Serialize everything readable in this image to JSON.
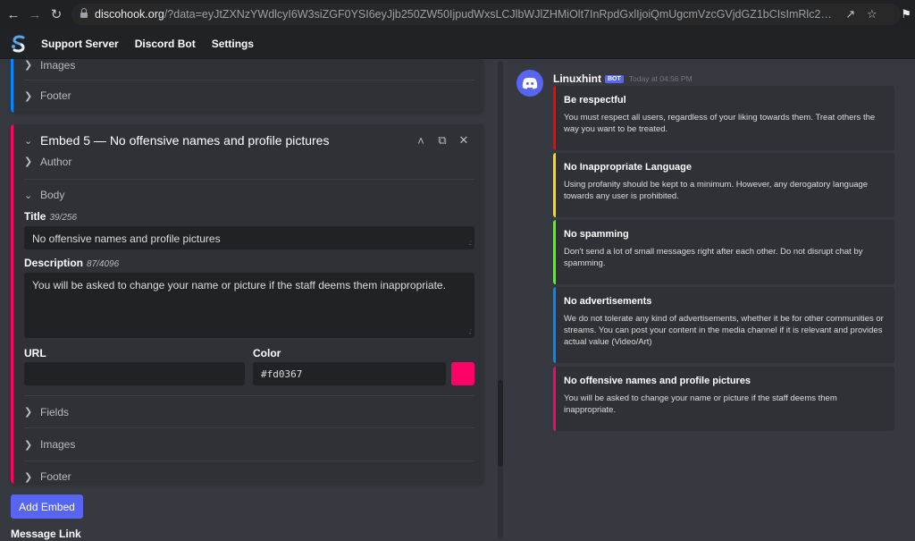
{
  "browser": {
    "url_host": "discohook.org",
    "url_rest": "/?data=eyJtZXNzYWdlcyI6W3siZGF0YSI6eyJjb250ZW50IjpudWxsLCJlbWJlZHMiOlt7InRpdGxlIjoiQmUgcmVzcGVjdGZ1bCIsImRlc2NyaXB0aW9uIjoiWW91IG11c3QgcmVzcGVjj...",
    "icons": [
      "back-arrow",
      "forward-arrow",
      "reload",
      "lock",
      "share",
      "star",
      "extensions"
    ]
  },
  "header": {
    "nav": [
      "Support Server",
      "Discord Bot",
      "Settings"
    ]
  },
  "editor": {
    "prev_embed": {
      "accent": "#0088ff",
      "sections": [
        "Images",
        "Footer"
      ]
    },
    "embed5": {
      "accent": "#fd0367",
      "header_title": "Embed 5 — No offensive names and profile pictures",
      "author_label": "Author",
      "body_label": "Body",
      "title_label": "Title",
      "title_count": "39/256",
      "title_value": "No offensive names and profile pictures",
      "description_label": "Description",
      "description_count": "87/4096",
      "description_value": "You will be asked to change your name or picture if the staff deems them inappropriate.",
      "url_label": "URL",
      "url_value": "",
      "color_label": "Color",
      "color_value": "#fd0367",
      "sections_after": [
        "Fields",
        "Images",
        "Footer"
      ]
    },
    "add_embed_label": "Add Embed",
    "message_link_label": "Message Link"
  },
  "preview": {
    "username": "Linuxhint",
    "bot_tag": "BOT",
    "timestamp": "Today at 04:56 PM",
    "embeds": [
      {
        "color": "#ff0000",
        "title": "Be respectful",
        "description": "You must respect all users, regardless of your liking towards them. Treat others the way you want to be treated."
      },
      {
        "color": "#ffd800",
        "title": "No Inappropriate Language",
        "description": "Using profanity should be kept to a minimum. However, any derogatory language towards any user is prohibited."
      },
      {
        "color": "#4cff00",
        "title": "No spamming",
        "description": "Don't send a lot of small messages right after each other. Do not disrupt chat by spamming."
      },
      {
        "color": "#0088ff",
        "title": "No advertisements",
        "description": "We do not tolerate any kind of advertisements, whether it be for other communities or streams. You can post your content in the media channel if it is relevant and provides actual value (Video/Art)"
      },
      {
        "color": "#fd0367",
        "title": "No offensive names and profile pictures",
        "description": "You will be asked to change your name or picture if the staff deems them inappropriate."
      }
    ]
  }
}
